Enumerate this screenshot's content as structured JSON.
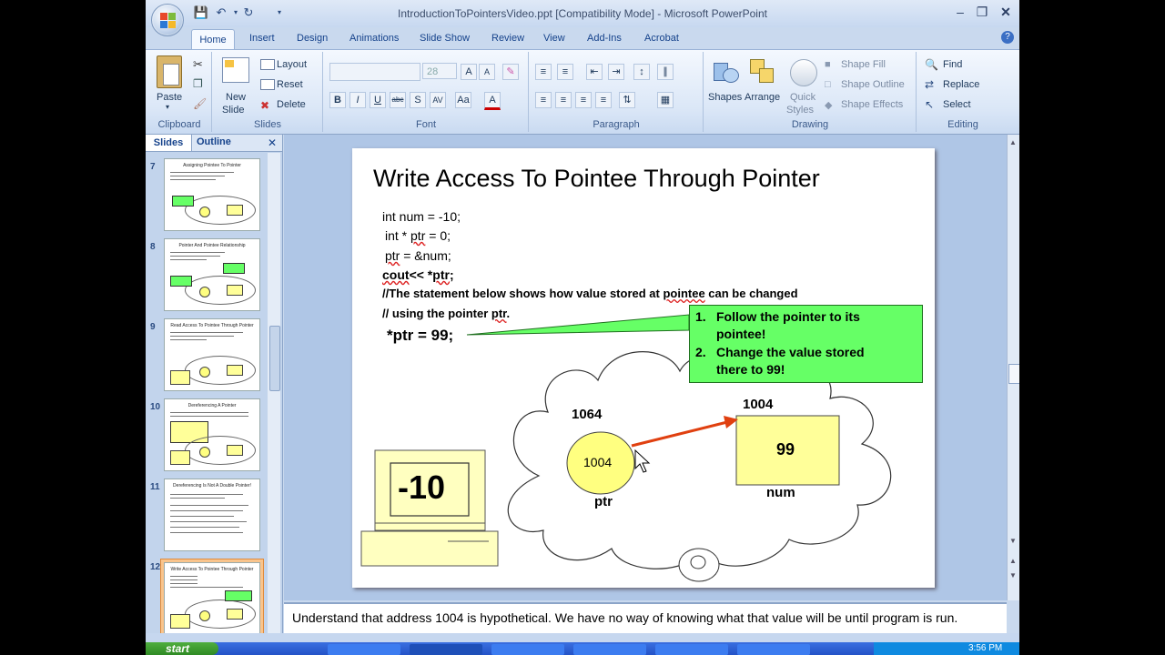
{
  "window": {
    "title": "IntroductionToPointersVideo.ppt [Compatibility Mode] - Microsoft PowerPoint"
  },
  "ribbon": {
    "tabs": [
      "Home",
      "Insert",
      "Design",
      "Animations",
      "Slide Show",
      "Review",
      "View",
      "Add-Ins",
      "Acrobat"
    ],
    "clipboard": {
      "label": "Clipboard",
      "paste": "Paste"
    },
    "slides": {
      "label": "Slides",
      "new_slide_line1": "New",
      "new_slide_line2": "Slide",
      "layout": "Layout",
      "reset": "Reset",
      "delete": "Delete"
    },
    "font": {
      "label": "Font",
      "size": "28"
    },
    "paragraph": {
      "label": "Paragraph"
    },
    "drawing": {
      "label": "Drawing",
      "shapes": "Shapes",
      "arrange": "Arrange",
      "quick_styles_1": "Quick",
      "quick_styles_2": "Styles",
      "shape_fill": "Shape Fill",
      "shape_outline": "Shape Outline",
      "shape_effects": "Shape Effects"
    },
    "editing": {
      "label": "Editing",
      "find": "Find",
      "replace": "Replace",
      "select": "Select"
    }
  },
  "pane": {
    "tabs": [
      "Slides",
      "Outline"
    ],
    "thumbnails": [
      {
        "num": "7",
        "title": "Assigning Pointee To Pointer"
      },
      {
        "num": "8",
        "title": "Pointer And Pointee Relationship"
      },
      {
        "num": "9",
        "title": "Read Access To Pointee Through Pointer"
      },
      {
        "num": "10",
        "title": "Dereferencing A Pointer"
      },
      {
        "num": "11",
        "title": "Dereferencing Is Not A Double Pointer!"
      },
      {
        "num": "12",
        "title": "Write Access To Pointee Through Pointer"
      }
    ]
  },
  "slide": {
    "title": "Write Access To Pointee Through Pointer",
    "code": {
      "line1": "int num = -10;",
      "line2_a": "int * ",
      "line2_b": "ptr",
      "line2_c": " = 0;",
      "line3_a": "ptr",
      "line3_b": " = &num;",
      "line4_a": "cout",
      "line4_b": "<< *",
      "line4_c": "ptr",
      "line4_d": ";",
      "line5_a": "//The statement below shows how value stored at ",
      "line5_b": "pointee",
      "line5_c": " can be changed",
      "line6_a": "// using the pointer ",
      "line6_b": "ptr",
      "line6_c": ".",
      "line7": "*ptr = 99;"
    },
    "callout": {
      "item1_num": "1.",
      "item1_a": "Follow the pointer to its",
      "item1_b": "pointee!",
      "item2_num": "2.",
      "item2_a": "Change the value stored",
      "item2_b": "there to  99!"
    },
    "memory": {
      "ptr_address": "1064",
      "ptr_value": "1004",
      "ptr_label": "ptr",
      "num_address": "1004",
      "num_value": "99",
      "num_label": "num"
    },
    "monitor_value": "-10"
  },
  "notes": "Understand that address 1004 is hypothetical. We have no way of knowing what that value will be until program  is run.",
  "taskbar": {
    "start": "start",
    "clock": "3:56 PM"
  }
}
